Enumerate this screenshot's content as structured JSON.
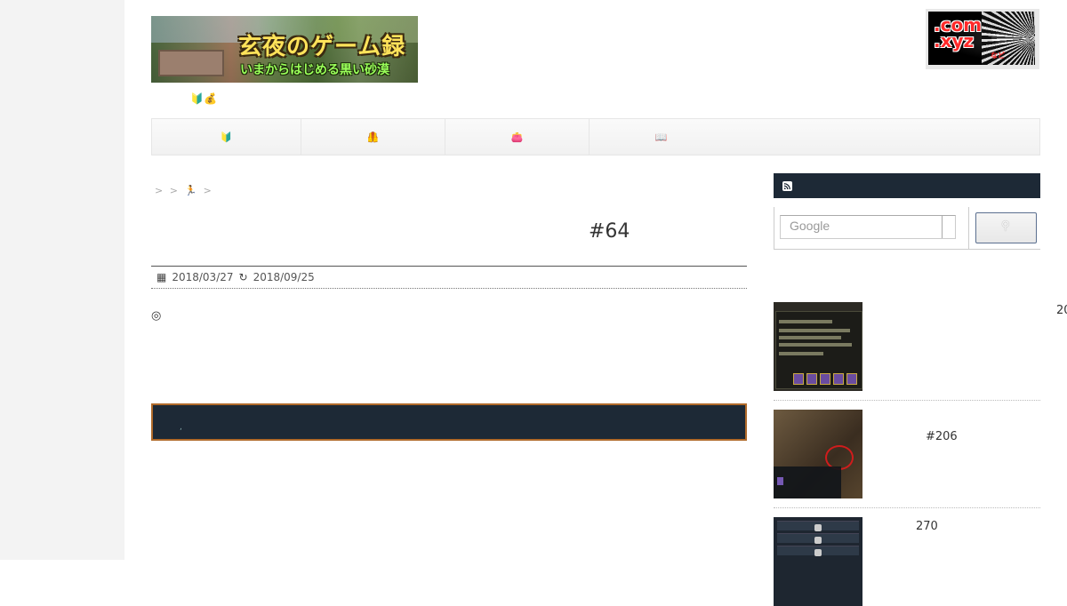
{
  "header": {
    "banner_title": "玄夜のゲーム録",
    "banner_subtitle": "いまからはじめる黒い砂漠",
    "tagline_icons": "🔰💰"
  },
  "badge": {
    "line1": ".com",
    "line2": ".xyz",
    "small": "など"
  },
  "nav": {
    "items": [
      {
        "icon": "🔰"
      },
      {
        "icon": "🦺"
      },
      {
        "icon": "👛"
      },
      {
        "icon": "📖"
      }
    ]
  },
  "breadcrumb": {
    "sep": ">",
    "runner": "🏃"
  },
  "post": {
    "title": "#64",
    "published": "2018/03/27",
    "updated": "2018/09/25",
    "body_mark": "◎"
  },
  "dark_box": {
    "text": ","
  },
  "search": {
    "placeholder": "Google"
  },
  "sidebar": {
    "items": [
      {
        "label": "20"
      },
      {
        "label": "#206"
      },
      {
        "label": "270"
      }
    ]
  }
}
